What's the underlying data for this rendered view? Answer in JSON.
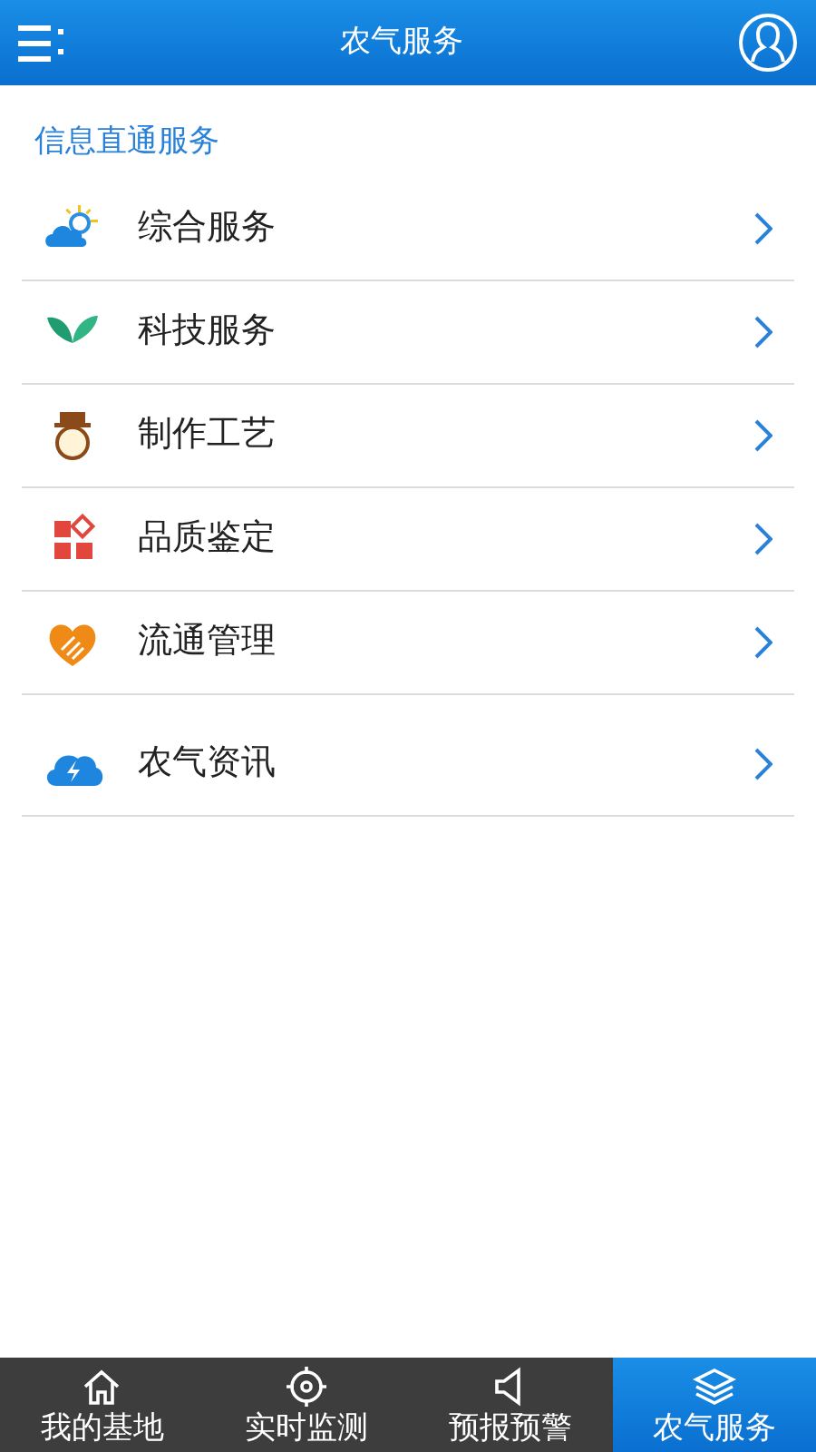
{
  "header": {
    "title": "农气服务"
  },
  "section_title": "信息直通服务",
  "groups": [
    {
      "items": [
        {
          "label": "综合服务",
          "kind": "cloud-sun"
        },
        {
          "label": "科技服务",
          "kind": "leaf"
        },
        {
          "label": "制作工艺",
          "kind": "hat"
        },
        {
          "label": "品质鉴定",
          "kind": "squares"
        },
        {
          "label": "流通管理",
          "kind": "heart"
        }
      ]
    },
    {
      "items": [
        {
          "label": "农气资讯",
          "kind": "cloud-bolt"
        }
      ]
    }
  ],
  "tabs": [
    {
      "label": "我的基地",
      "kind": "home",
      "selected": false
    },
    {
      "label": "实时监测",
      "kind": "target",
      "selected": false
    },
    {
      "label": "预报预警",
      "kind": "speaker",
      "selected": false
    },
    {
      "label": "农气服务",
      "kind": "layers",
      "selected": true
    }
  ]
}
